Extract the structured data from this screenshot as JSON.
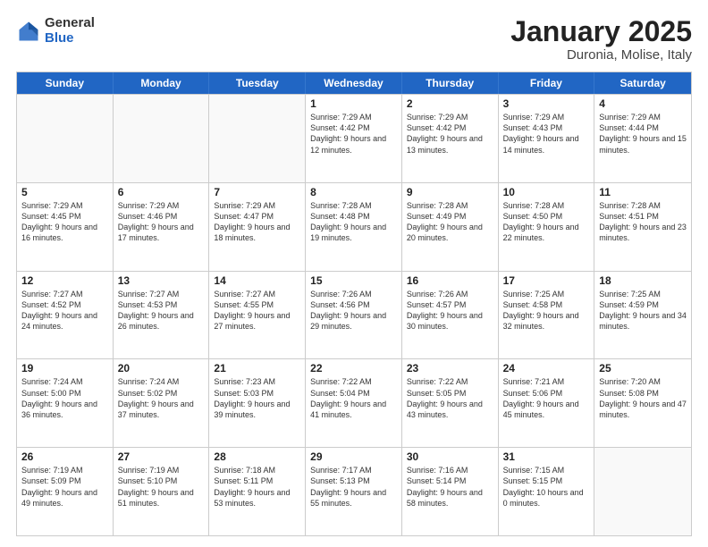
{
  "logo": {
    "general": "General",
    "blue": "Blue"
  },
  "header": {
    "title": "January 2025",
    "subtitle": "Duronia, Molise, Italy"
  },
  "weekdays": [
    "Sunday",
    "Monday",
    "Tuesday",
    "Wednesday",
    "Thursday",
    "Friday",
    "Saturday"
  ],
  "rows": [
    [
      {
        "day": "",
        "info": ""
      },
      {
        "day": "",
        "info": ""
      },
      {
        "day": "",
        "info": ""
      },
      {
        "day": "1",
        "info": "Sunrise: 7:29 AM\nSunset: 4:42 PM\nDaylight: 9 hours and 12 minutes."
      },
      {
        "day": "2",
        "info": "Sunrise: 7:29 AM\nSunset: 4:42 PM\nDaylight: 9 hours and 13 minutes."
      },
      {
        "day": "3",
        "info": "Sunrise: 7:29 AM\nSunset: 4:43 PM\nDaylight: 9 hours and 14 minutes."
      },
      {
        "day": "4",
        "info": "Sunrise: 7:29 AM\nSunset: 4:44 PM\nDaylight: 9 hours and 15 minutes."
      }
    ],
    [
      {
        "day": "5",
        "info": "Sunrise: 7:29 AM\nSunset: 4:45 PM\nDaylight: 9 hours and 16 minutes."
      },
      {
        "day": "6",
        "info": "Sunrise: 7:29 AM\nSunset: 4:46 PM\nDaylight: 9 hours and 17 minutes."
      },
      {
        "day": "7",
        "info": "Sunrise: 7:29 AM\nSunset: 4:47 PM\nDaylight: 9 hours and 18 minutes."
      },
      {
        "day": "8",
        "info": "Sunrise: 7:28 AM\nSunset: 4:48 PM\nDaylight: 9 hours and 19 minutes."
      },
      {
        "day": "9",
        "info": "Sunrise: 7:28 AM\nSunset: 4:49 PM\nDaylight: 9 hours and 20 minutes."
      },
      {
        "day": "10",
        "info": "Sunrise: 7:28 AM\nSunset: 4:50 PM\nDaylight: 9 hours and 22 minutes."
      },
      {
        "day": "11",
        "info": "Sunrise: 7:28 AM\nSunset: 4:51 PM\nDaylight: 9 hours and 23 minutes."
      }
    ],
    [
      {
        "day": "12",
        "info": "Sunrise: 7:27 AM\nSunset: 4:52 PM\nDaylight: 9 hours and 24 minutes."
      },
      {
        "day": "13",
        "info": "Sunrise: 7:27 AM\nSunset: 4:53 PM\nDaylight: 9 hours and 26 minutes."
      },
      {
        "day": "14",
        "info": "Sunrise: 7:27 AM\nSunset: 4:55 PM\nDaylight: 9 hours and 27 minutes."
      },
      {
        "day": "15",
        "info": "Sunrise: 7:26 AM\nSunset: 4:56 PM\nDaylight: 9 hours and 29 minutes."
      },
      {
        "day": "16",
        "info": "Sunrise: 7:26 AM\nSunset: 4:57 PM\nDaylight: 9 hours and 30 minutes."
      },
      {
        "day": "17",
        "info": "Sunrise: 7:25 AM\nSunset: 4:58 PM\nDaylight: 9 hours and 32 minutes."
      },
      {
        "day": "18",
        "info": "Sunrise: 7:25 AM\nSunset: 4:59 PM\nDaylight: 9 hours and 34 minutes."
      }
    ],
    [
      {
        "day": "19",
        "info": "Sunrise: 7:24 AM\nSunset: 5:00 PM\nDaylight: 9 hours and 36 minutes."
      },
      {
        "day": "20",
        "info": "Sunrise: 7:24 AM\nSunset: 5:02 PM\nDaylight: 9 hours and 37 minutes."
      },
      {
        "day": "21",
        "info": "Sunrise: 7:23 AM\nSunset: 5:03 PM\nDaylight: 9 hours and 39 minutes."
      },
      {
        "day": "22",
        "info": "Sunrise: 7:22 AM\nSunset: 5:04 PM\nDaylight: 9 hours and 41 minutes."
      },
      {
        "day": "23",
        "info": "Sunrise: 7:22 AM\nSunset: 5:05 PM\nDaylight: 9 hours and 43 minutes."
      },
      {
        "day": "24",
        "info": "Sunrise: 7:21 AM\nSunset: 5:06 PM\nDaylight: 9 hours and 45 minutes."
      },
      {
        "day": "25",
        "info": "Sunrise: 7:20 AM\nSunset: 5:08 PM\nDaylight: 9 hours and 47 minutes."
      }
    ],
    [
      {
        "day": "26",
        "info": "Sunrise: 7:19 AM\nSunset: 5:09 PM\nDaylight: 9 hours and 49 minutes."
      },
      {
        "day": "27",
        "info": "Sunrise: 7:19 AM\nSunset: 5:10 PM\nDaylight: 9 hours and 51 minutes."
      },
      {
        "day": "28",
        "info": "Sunrise: 7:18 AM\nSunset: 5:11 PM\nDaylight: 9 hours and 53 minutes."
      },
      {
        "day": "29",
        "info": "Sunrise: 7:17 AM\nSunset: 5:13 PM\nDaylight: 9 hours and 55 minutes."
      },
      {
        "day": "30",
        "info": "Sunrise: 7:16 AM\nSunset: 5:14 PM\nDaylight: 9 hours and 58 minutes."
      },
      {
        "day": "31",
        "info": "Sunrise: 7:15 AM\nSunset: 5:15 PM\nDaylight: 10 hours and 0 minutes."
      },
      {
        "day": "",
        "info": ""
      }
    ]
  ]
}
